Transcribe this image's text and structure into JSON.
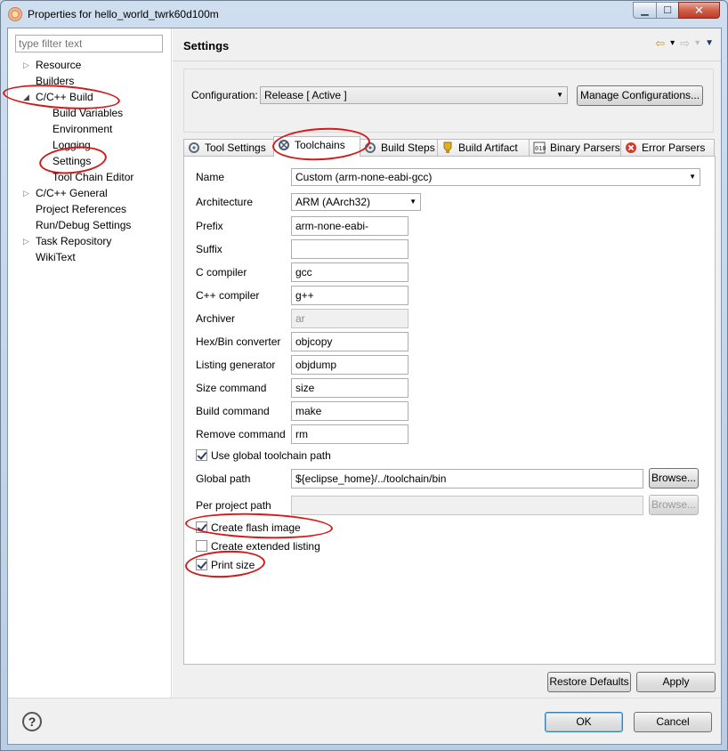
{
  "window": {
    "title": "Properties for hello_world_twrk60d100m",
    "min_glyph": "▁",
    "max_glyph": "☐",
    "close_glyph": "✕"
  },
  "filter": {
    "placeholder": "type filter text"
  },
  "tree": {
    "items": [
      {
        "label": "Resource"
      },
      {
        "label": "Builders"
      },
      {
        "label": "C/C++ Build"
      },
      {
        "label": "Build Variables"
      },
      {
        "label": "Environment"
      },
      {
        "label": "Logging"
      },
      {
        "label": "Settings"
      },
      {
        "label": "Tool Chain Editor"
      },
      {
        "label": "C/C++ General"
      },
      {
        "label": "Project References"
      },
      {
        "label": "Run/Debug Settings"
      },
      {
        "label": "Task Repository"
      },
      {
        "label": "WikiText"
      }
    ],
    "collapsed_glyph": "▷",
    "expanded_glyph": "◢"
  },
  "header": {
    "title": "Settings",
    "back_glyph": "⇦",
    "forward_glyph": "⇨",
    "dropdown_glyph": "▾",
    "menu_glyph": "▼"
  },
  "configuration": {
    "label": "Configuration:",
    "value": "Release  [ Active ]",
    "manage_button": "Manage Configurations..."
  },
  "tabs": [
    {
      "label": "Tool Settings",
      "icon": "tool-settings-icon"
    },
    {
      "label": "Toolchains",
      "icon": "toolchains-icon"
    },
    {
      "label": "Build Steps",
      "icon": "build-steps-icon"
    },
    {
      "label": "Build Artifact",
      "icon": "build-artifact-icon"
    },
    {
      "label": "Binary Parsers",
      "icon": "binary-parsers-icon"
    },
    {
      "label": "Error Parsers",
      "icon": "error-parsers-icon"
    }
  ],
  "toolchain": {
    "name_label": "Name",
    "name_value": "Custom (arm-none-eabi-gcc)",
    "architecture_label": "Architecture",
    "architecture_value": "ARM (AArch32)",
    "fields": [
      {
        "label": "Prefix",
        "value": "arm-none-eabi-"
      },
      {
        "label": "Suffix",
        "value": ""
      },
      {
        "label": "C compiler",
        "value": "gcc"
      },
      {
        "label": "C++ compiler",
        "value": "g++"
      },
      {
        "label": "Archiver",
        "value": "ar"
      },
      {
        "label": "Hex/Bin converter",
        "value": "objcopy"
      },
      {
        "label": "Listing generator",
        "value": "objdump"
      },
      {
        "label": "Size command",
        "value": "size"
      },
      {
        "label": "Build command",
        "value": "make"
      },
      {
        "label": "Remove command",
        "value": "rm"
      }
    ],
    "use_global_label": "Use global toolchain path",
    "global_path_label": "Global path",
    "global_path_value": "${eclipse_home}/../toolchain/bin",
    "per_project_label": "Per project path",
    "per_project_value": "",
    "browse_label": "Browse...",
    "create_flash_label": "Create flash image",
    "create_listing_label": "Create extended listing",
    "print_size_label": "Print size"
  },
  "buttons": {
    "restore_defaults": "Restore Defaults",
    "apply": "Apply",
    "ok": "OK",
    "cancel": "Cancel",
    "help_glyph": "?"
  },
  "colors": {
    "annotation": "#d21a1a"
  }
}
